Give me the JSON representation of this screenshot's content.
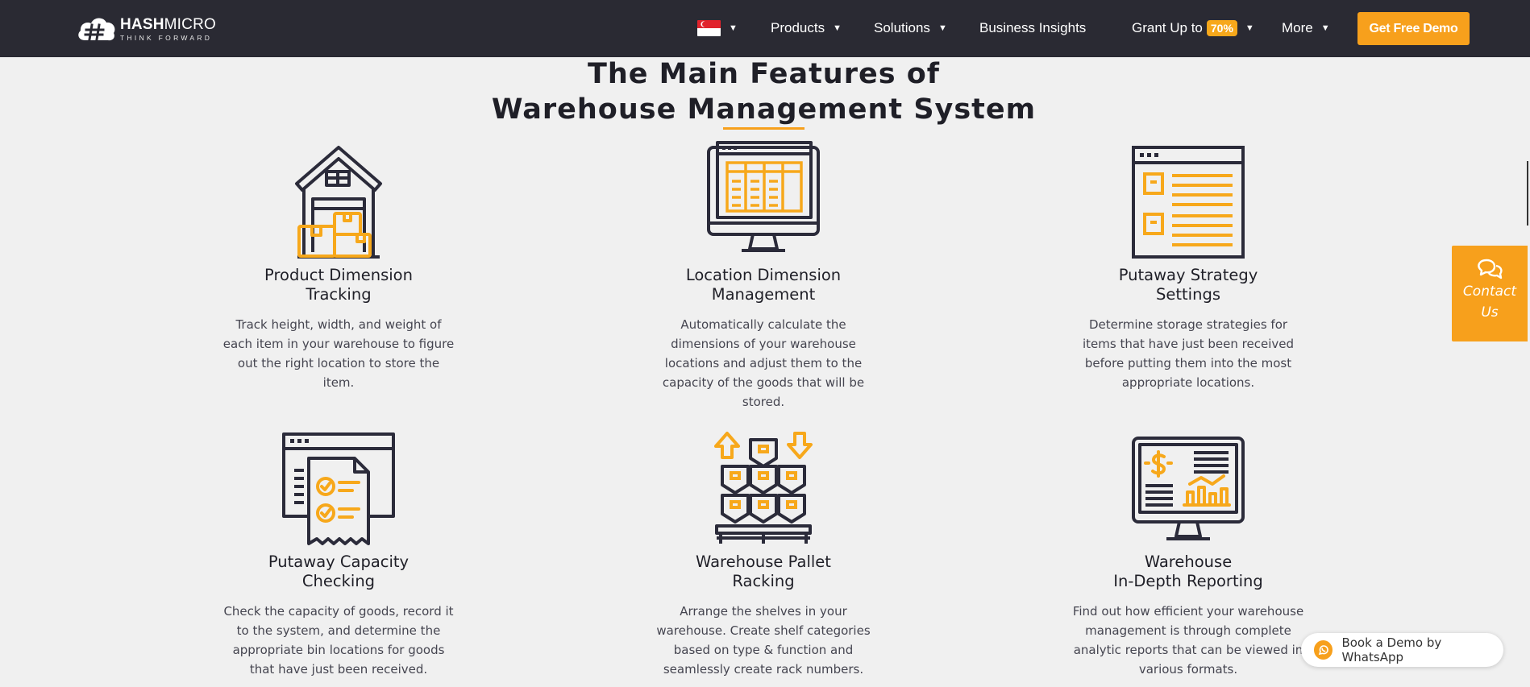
{
  "nav": {
    "logo_name_bold": "HASH",
    "logo_name_thin": "MICRO",
    "logo_tagline": "THINK FORWARD",
    "items": [
      {
        "label": "Products"
      },
      {
        "label": "Solutions"
      },
      {
        "label": "Business Insights"
      },
      {
        "label": "Grant Up to",
        "badge": "70%"
      },
      {
        "label": "More"
      }
    ],
    "caret": "▼",
    "cta": "Get Free Demo",
    "flag": "singapore-flag",
    "accent_color": "#f7a01c",
    "bar_color": "#2a2a33"
  },
  "section": {
    "title_line1": "The Main Features of",
    "title_line2": "Warehouse Management System"
  },
  "features": [
    {
      "icon": "warehouse-boxes-icon",
      "title_line1": "Product Dimension",
      "title_line2": "Tracking",
      "desc": "Track height, width, and weight of each item in your warehouse to figure out the right location to store the item."
    },
    {
      "icon": "monitor-table-icon",
      "title_line1": "Location Dimension",
      "title_line2": "Management",
      "desc": "Automatically calculate the dimensions of your warehouse locations and adjust them to the capacity of the goods that will be stored."
    },
    {
      "icon": "browser-list-icon",
      "title_line1": "Putaway Strategy",
      "title_line2": "Settings",
      "desc": "Determine storage strategies for items that have just been received before putting them into the most appropriate locations."
    },
    {
      "icon": "checklist-receipt-icon",
      "title_line1": "Putaway Capacity",
      "title_line2": "Checking",
      "desc": "Check the capacity of goods, record it to the system, and determine the appropriate bin locations for goods that have just been received."
    },
    {
      "icon": "pallet-racking-icon",
      "title_line1": "Warehouse Pallet",
      "title_line2": "Racking",
      "desc": "Arrange the shelves in your warehouse. Create shelf categories based on type & function and seamlessly create rack numbers."
    },
    {
      "icon": "monitor-report-icon",
      "title_line1": "Warehouse",
      "title_line2": "In-Depth Reporting",
      "desc": "Find out how efficient your warehouse management is through complete analytic reports that can be viewed in various formats."
    }
  ],
  "contact": {
    "label": "Contact Us"
  },
  "whatsapp": {
    "label": "Book a Demo by WhatsApp"
  }
}
